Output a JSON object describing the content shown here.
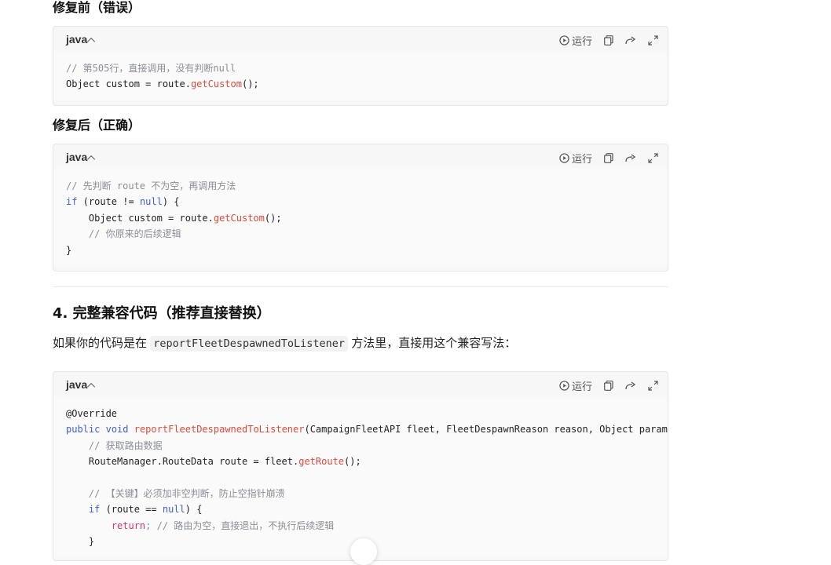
{
  "sections": {
    "before_title": "修复前（错误）",
    "after_title": "修复后（正确）",
    "sec4_title": "4. 完整兼容代码（推荐直接替换）",
    "intro_prefix": "如果你的代码是在",
    "intro_code": "reportFleetDespawnedToListener",
    "intro_suffix": "方法里，直接用这个兼容写法："
  },
  "blocks": [
    {
      "lang": "java",
      "run_label": "运行",
      "lines": [
        "// 第505行，直接调用，没有判断null",
        "Object custom = route.",
        "getCustom",
        "();"
      ]
    },
    {
      "lang": "java",
      "run_label": "运行",
      "lines": [
        "// 先判断 route 不为空，再调用方法",
        "if",
        " (route != ",
        "null",
        ") {",
        "    Object custom = route.",
        "getCustom",
        "();",
        "    // 你原来的后续逻辑",
        "}"
      ]
    },
    {
      "lang": "java",
      "run_label": "运行",
      "lines": [
        "@Override",
        "public",
        "void",
        "reportFleetDespawnedToListener",
        "(CampaignFleetAPI fleet, FleetDespawnReason reason, Object param)",
        "    // 获取路由数据",
        "    RouteManager.RouteData route = fleet.",
        "getRoute",
        "();",
        "    // 【关键】必须加非空判断，防止空指针崩溃",
        "if",
        " (route == ",
        "null",
        ") {",
        "return",
        "; // 路由为空，直接退出，不执行后续逻辑",
        "    }"
      ]
    }
  ]
}
